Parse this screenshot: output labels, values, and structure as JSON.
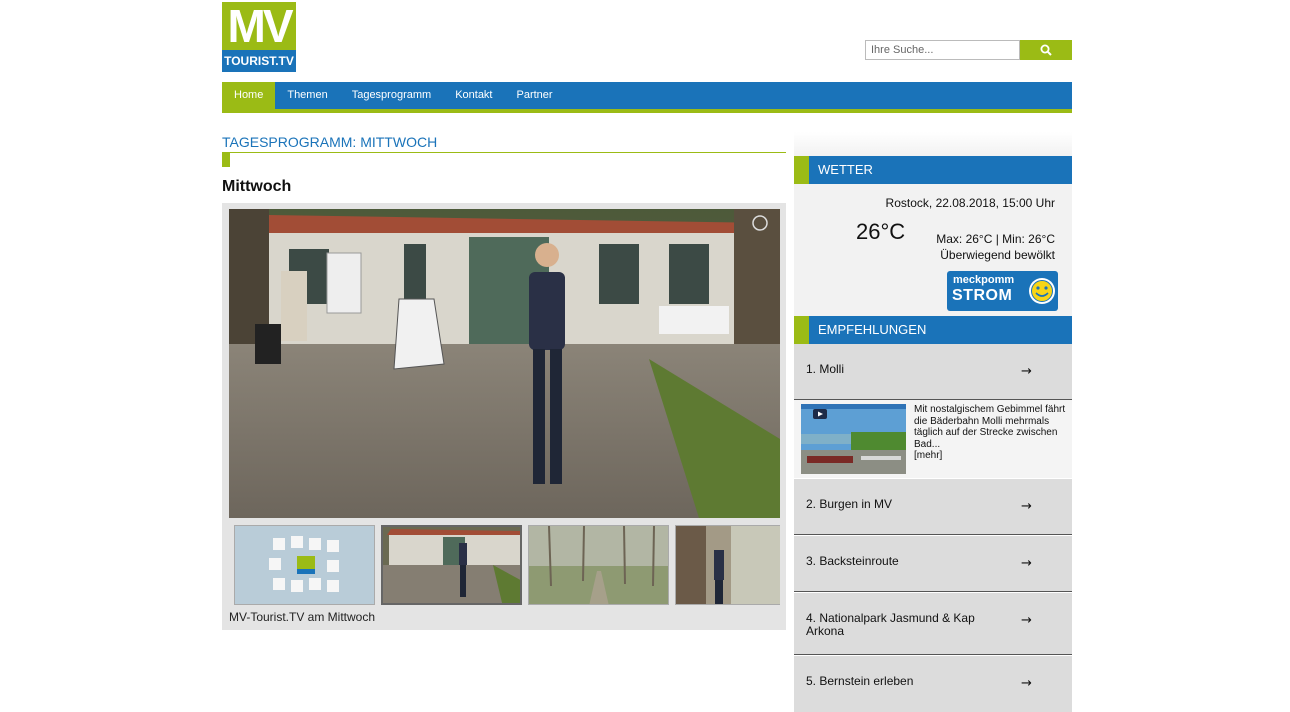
{
  "logo": {
    "top": "MV",
    "bottom": "TOURIST.TV"
  },
  "search": {
    "placeholder": "Ihre Suche..."
  },
  "nav": {
    "items": [
      "Home",
      "Themen",
      "Tagesprogramm",
      "Kontakt",
      "Partner"
    ],
    "active": "Home"
  },
  "main": {
    "section_title": "TAGESPROGRAMM: MITTWOCH",
    "title": "Mittwoch",
    "player_caption": "MV-Tourist.TV am Mittwoch"
  },
  "weather": {
    "header": "WETTER",
    "location": "Rostock, 22.08.2018, 15:00 Uhr",
    "temp": "26°C",
    "minmax": "Max: 26°C | Min: 26°C",
    "description": "Überwiegend bewölkt",
    "sponsor": {
      "line1": "meckpomm",
      "line2": "STROM"
    }
  },
  "recommendations": {
    "header": "EMPFEHLUNGEN",
    "items": [
      {
        "label": "1. Molli"
      },
      {
        "label": "2. Burgen in MV"
      },
      {
        "label": "3. Backsteinroute"
      },
      {
        "label": "4. Nationalpark Jasmund & Kap Arkona"
      },
      {
        "label": "5. Bernstein erleben"
      }
    ],
    "expanded_text": "Mit nostalgischem Gebimmel fährt die Bäderbahn Molli mehrmals täglich auf der Strecke zwischen Bad...",
    "more": "[mehr]",
    "arrow": "→"
  },
  "colors": {
    "brand_green": "#9bbb15",
    "brand_blue": "#1a73b9"
  }
}
